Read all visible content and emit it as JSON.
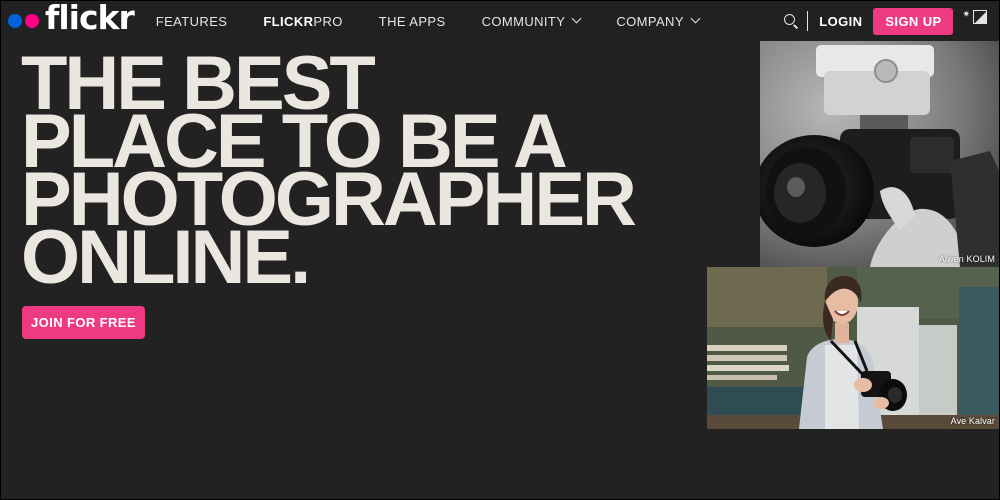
{
  "brand": {
    "logo_text": "flickr",
    "dot_colors": [
      "#0063dc",
      "#ff0084"
    ]
  },
  "nav": {
    "links": [
      {
        "label": "FEATURES",
        "has_dropdown": false
      },
      {
        "label_strong": "FLICKR",
        "label_light": "PRO",
        "has_dropdown": false
      },
      {
        "label": "THE APPS",
        "has_dropdown": false
      },
      {
        "label": "COMMUNITY",
        "has_dropdown": true
      },
      {
        "label": "COMPANY",
        "has_dropdown": true
      }
    ],
    "search_icon": "search-icon",
    "login_label": "LOGIN",
    "signup_label": "SIGN UP",
    "theme_icons": [
      "sun-icon",
      "contrast-icon"
    ]
  },
  "hero": {
    "title_lines": [
      "THE BEST",
      "PLACE TO BE A",
      "PHOTOGRAPHER",
      "ONLINE."
    ],
    "cta_label": "JOIN FOR FREE"
  },
  "photos": [
    {
      "credit": "Alwen KOLIM",
      "description_icon": "camera-closeup-photo"
    },
    {
      "credit": "Ave Kalvar",
      "description_icon": "photographer-portrait-photo"
    }
  ],
  "colors": {
    "background": "#222222",
    "accent": "#ec3b82",
    "hero_text": "#ebe7e0"
  }
}
